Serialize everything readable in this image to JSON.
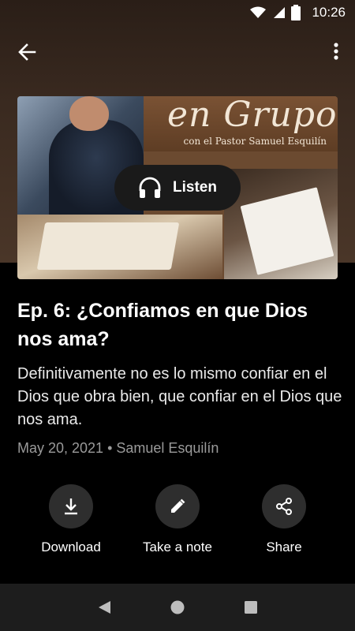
{
  "status_bar": {
    "time": "10:26",
    "icons": [
      "wifi-icon",
      "cell-signal-icon",
      "battery-icon"
    ]
  },
  "app_bar": {
    "back_icon": "arrow-left-icon",
    "menu_icon": "more-vertical-icon"
  },
  "artwork": {
    "title": "en Grupo",
    "subtitle": "con el Pastor Samuel Esquilín"
  },
  "listen_button": {
    "label": "Listen",
    "icon": "headphones-icon"
  },
  "episode": {
    "title": "Ep. 6: ¿Confiamos en que Dios nos ama?",
    "description": "Definitivamente no es lo mismo confiar en el Dios que obra bien, que confiar en el Dios que nos ama.",
    "meta": "May 20, 2021 • Samuel Esquilín"
  },
  "actions": [
    {
      "label": "Download",
      "icon": "download-icon"
    },
    {
      "label": "Take a note",
      "icon": "pencil-icon"
    },
    {
      "label": "Share",
      "icon": "share-icon"
    }
  ],
  "nav_bar": {
    "icons": [
      "back-triangle-icon",
      "home-circle-icon",
      "recents-square-icon"
    ]
  },
  "colors": {
    "background": "#000000",
    "hero": "#3a2a20",
    "button_circle": "#2e2e2e",
    "meta_text": "#9a9a9a"
  }
}
